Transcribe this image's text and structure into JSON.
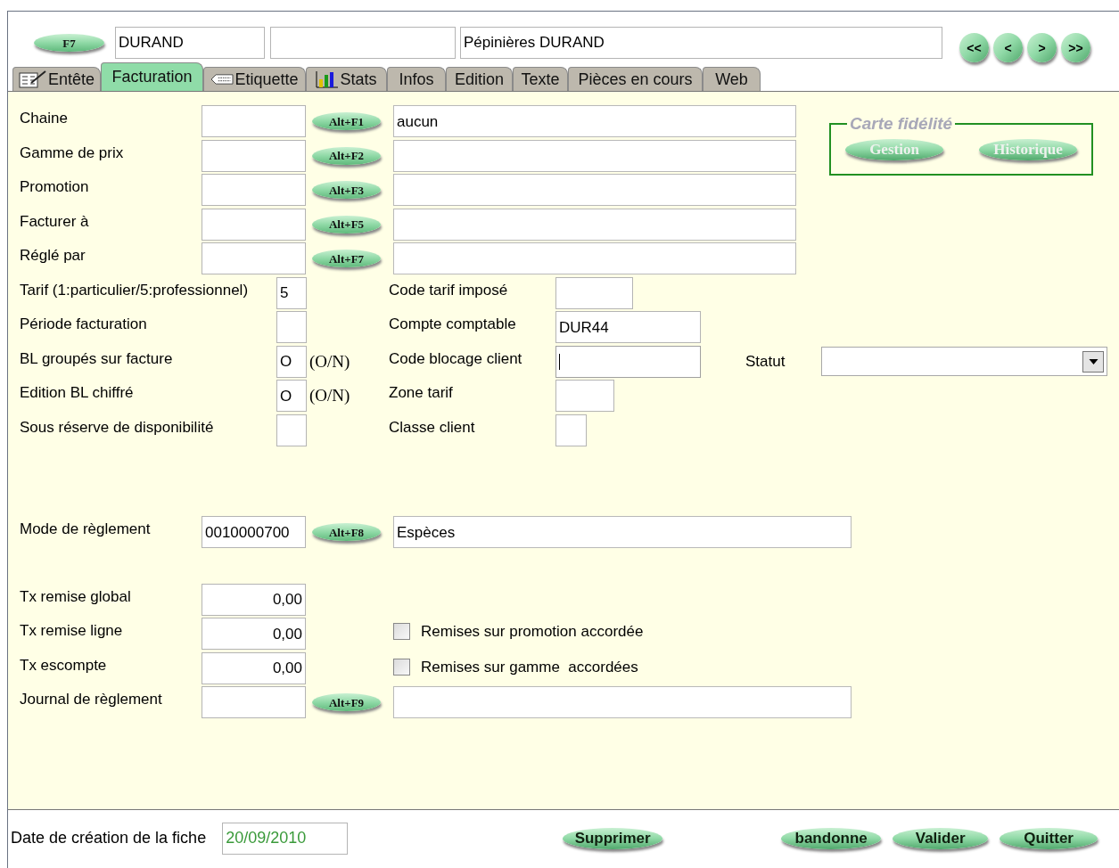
{
  "header": {
    "lookup_button": "F7",
    "code": "DURAND",
    "company": "Pépinières DURAND"
  },
  "nav_buttons": [
    "<<",
    "<",
    ">",
    ">>"
  ],
  "tabs": [
    {
      "label": "Entête",
      "selected": false
    },
    {
      "label": "Facturation",
      "selected": true
    },
    {
      "label": "Etiquette",
      "selected": false
    },
    {
      "label": "Stats",
      "selected": false
    },
    {
      "label": "Infos",
      "selected": false
    },
    {
      "label": "Edition",
      "selected": false
    },
    {
      "label": "Texte",
      "selected": false
    },
    {
      "label": "Pièces en cours",
      "selected": false
    },
    {
      "label": "Web",
      "selected": false
    }
  ],
  "lookup_rows": [
    {
      "label": "Chaine",
      "shortcut": "Alt+F1",
      "description": "aucun"
    },
    {
      "label": "Gamme de prix",
      "shortcut": "Alt+F2"
    },
    {
      "label": "Promotion",
      "shortcut": "Alt+F3"
    },
    {
      "label": "Facturer à",
      "shortcut": "Alt+F5"
    },
    {
      "label": "Réglé par",
      "shortcut": "Alt+F7"
    }
  ],
  "carte_fidelite": {
    "title": "Carte fidélité",
    "disabled": true,
    "buttons": [
      "Gestion",
      "Historique"
    ]
  },
  "option_rows": [
    {
      "label": "Tarif (1:particulier/5:professionnel)",
      "value": "5",
      "side_label": "Code tarif imposé"
    },
    {
      "label": "Période facturation",
      "side_label": "Compte comptable",
      "side_value": "DUR44"
    },
    {
      "label": "BL groupés sur facture",
      "value": "O",
      "suffix": "(O/N)",
      "side_label": "Code blocage client",
      "side_focused": true,
      "extra_label": "Statut"
    },
    {
      "label": "Edition BL chiffré",
      "value": "O",
      "suffix": "(O/N)",
      "side_label": "Zone tarif"
    },
    {
      "label": "Sous réserve de disponibilité",
      "side_label": "Classe client"
    }
  ],
  "payment_mode": {
    "label": "Mode de règlement",
    "code": "0010000700",
    "shortcut": "Alt+F8",
    "description": "Espèces"
  },
  "rates": [
    {
      "label": "Tx remise global",
      "value": "0,00"
    },
    {
      "label": "Tx remise ligne",
      "value": "0,00",
      "checkbox": {
        "label": "Remises sur promotion accordée",
        "checked": false
      }
    },
    {
      "label": "Tx escompte",
      "value": "0,00",
      "checkbox": {
        "label": "Remises sur gamme  accordées",
        "checked": false
      }
    }
  ],
  "journal": {
    "label": "Journal de règlement",
    "shortcut": "Alt+F9"
  },
  "footer": {
    "date_label": "Date de création de la fiche",
    "date_value": "20/09/2010",
    "buttons": [
      "Supprimer",
      "bandonne",
      "Valider",
      "Quitter"
    ]
  }
}
